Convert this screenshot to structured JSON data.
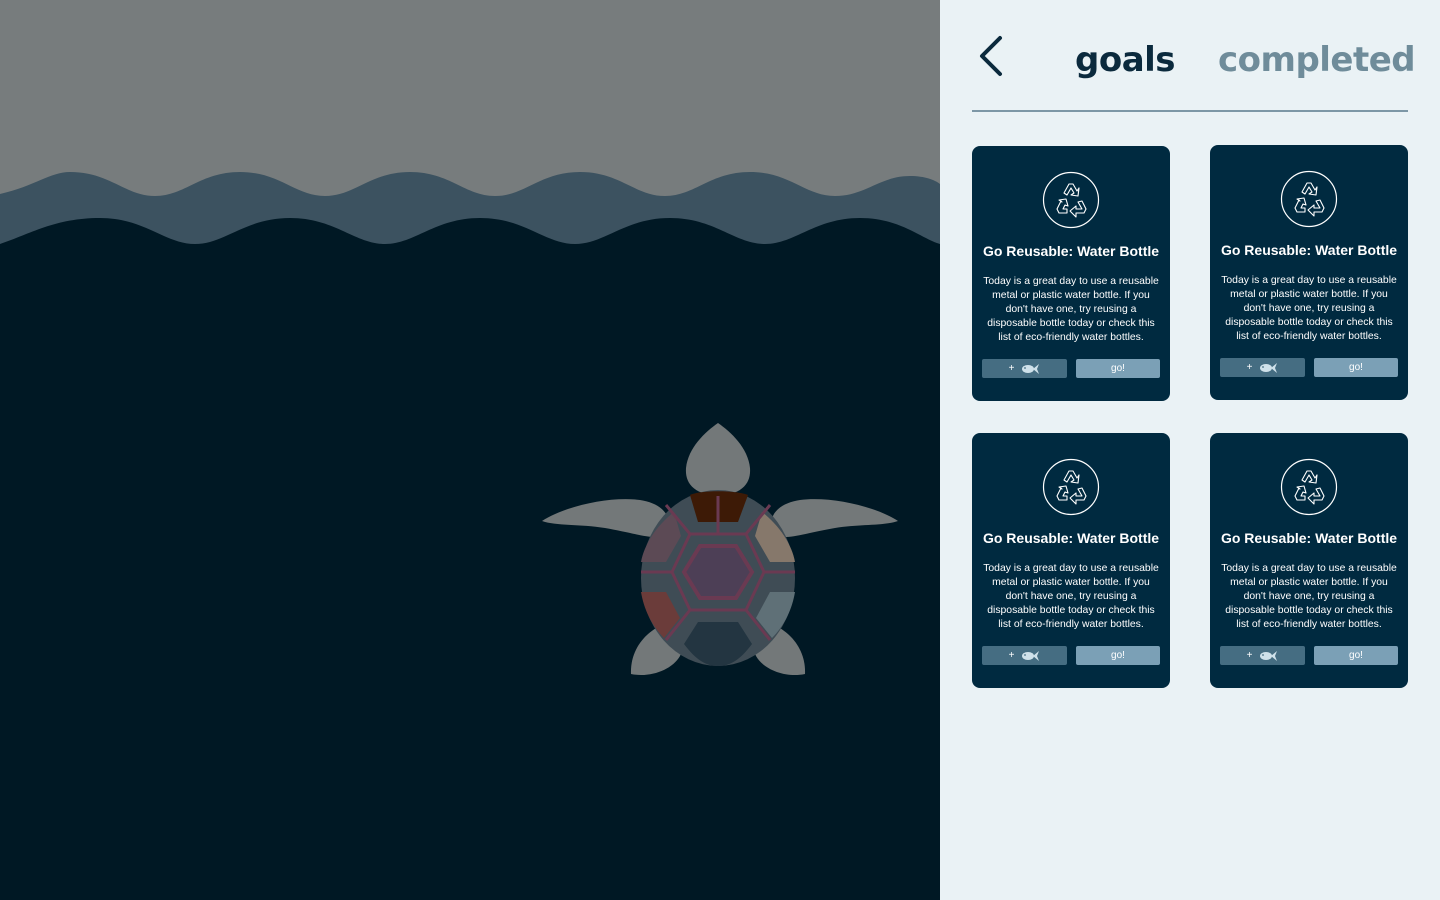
{
  "colors": {
    "sky": "#777c7d",
    "wave": "#3c5260",
    "ocean": "#001824",
    "panel_bg": "#eaf2f5",
    "card_bg": "#002a40",
    "tab_active": "#0b2a3d",
    "tab_inactive": "#6f8c9a",
    "btn_add": "#456d82",
    "btn_go": "#7ba0b6"
  },
  "scene": {
    "turtle_icon": "sea-turtle"
  },
  "header": {
    "back_icon": "chevron-left-icon",
    "tabs": [
      {
        "label": "goals",
        "active": true
      },
      {
        "label": "completed",
        "active": false
      }
    ]
  },
  "goals": [
    {
      "icon": "recycle-icon",
      "title": "Go Reusable: Water Bottle",
      "description": "Today is a great day to use a reusable metal or plastic water bottle. If you don't have one, try reusing a disposable bottle today or check this list of eco-friendly water bottles.",
      "add_label": "+",
      "add_icon": "fish-icon",
      "go_label": "go!"
    },
    {
      "icon": "recycle-icon",
      "title": "Go Reusable: Water Bottle",
      "description": "Today is a great day to use a reusable metal or plastic water bottle. If you don't have one, try reusing a disposable bottle today or check this list of eco-friendly water bottles.",
      "add_label": "+",
      "add_icon": "fish-icon",
      "go_label": "go!"
    },
    {
      "icon": "recycle-icon",
      "title": "Go Reusable: Water Bottle",
      "description": "Today is a great day to use a reusable metal or plastic water bottle. If you don't have one, try reusing a disposable bottle today or check this list of eco-friendly water bottles.",
      "add_label": "+",
      "add_icon": "fish-icon",
      "go_label": "go!"
    },
    {
      "icon": "recycle-icon",
      "title": "Go Reusable: Water Bottle",
      "description": "Today is a great day to use a reusable metal or plastic water bottle. If you don't have one, try reusing a disposable bottle today or check this list of eco-friendly water bottles.",
      "add_label": "+",
      "add_icon": "fish-icon",
      "go_label": "go!"
    }
  ]
}
